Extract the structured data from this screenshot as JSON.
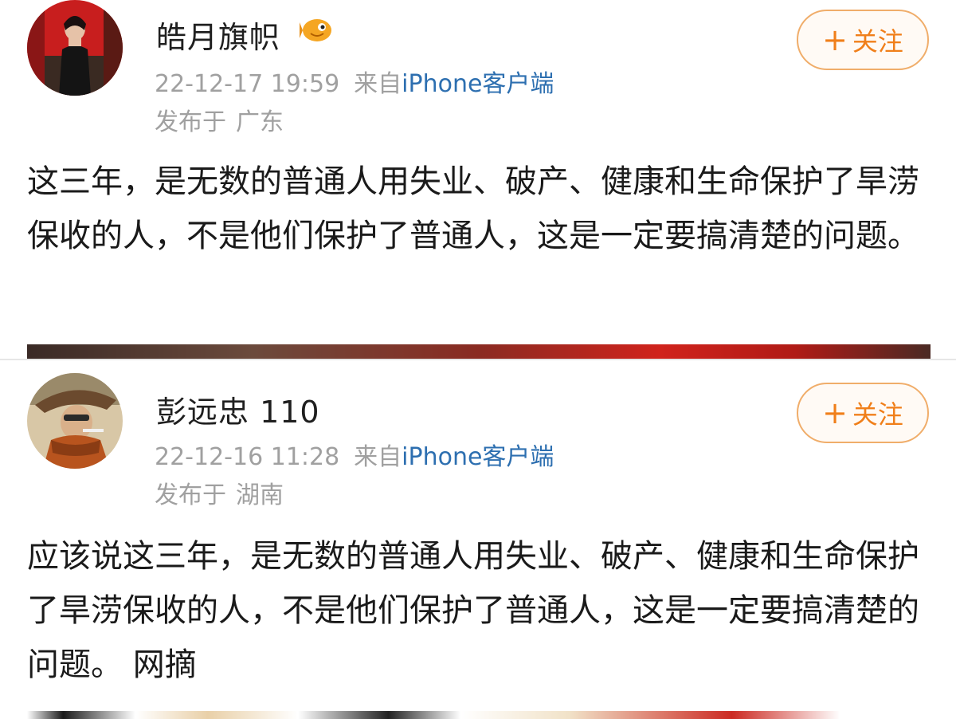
{
  "posts": [
    {
      "username": "皓月旗帜",
      "follow_plus": "+",
      "follow_label": "关注",
      "timestamp": "22-12-17 19:59",
      "source_prefix": "来自",
      "client": "iPhone客户端",
      "location_label": "发布于",
      "location": "广东",
      "text": "这三年，是无数的普通人用失业、破产、健康和生命保护了旱涝保收的人，不是他们保护了普通人，这是一定要搞清楚的问题。"
    },
    {
      "username": "彭远忠 110",
      "follow_plus": "+",
      "follow_label": "关注",
      "timestamp": "22-12-16 11:28",
      "source_prefix": "来自",
      "client": "iPhone客户端",
      "location_label": "发布于",
      "location": "湖南",
      "text": "应该说这三年，是无数的普通人用失业、破产、健康和生命保护了旱涝保收的人，不是他们保护了普通人，这是一定要搞清楚的问题。 网摘"
    }
  ],
  "colors": {
    "follow_accent": "#f07f1a",
    "client_link": "#2d6fb0",
    "meta_gray": "#a0a0a0"
  }
}
